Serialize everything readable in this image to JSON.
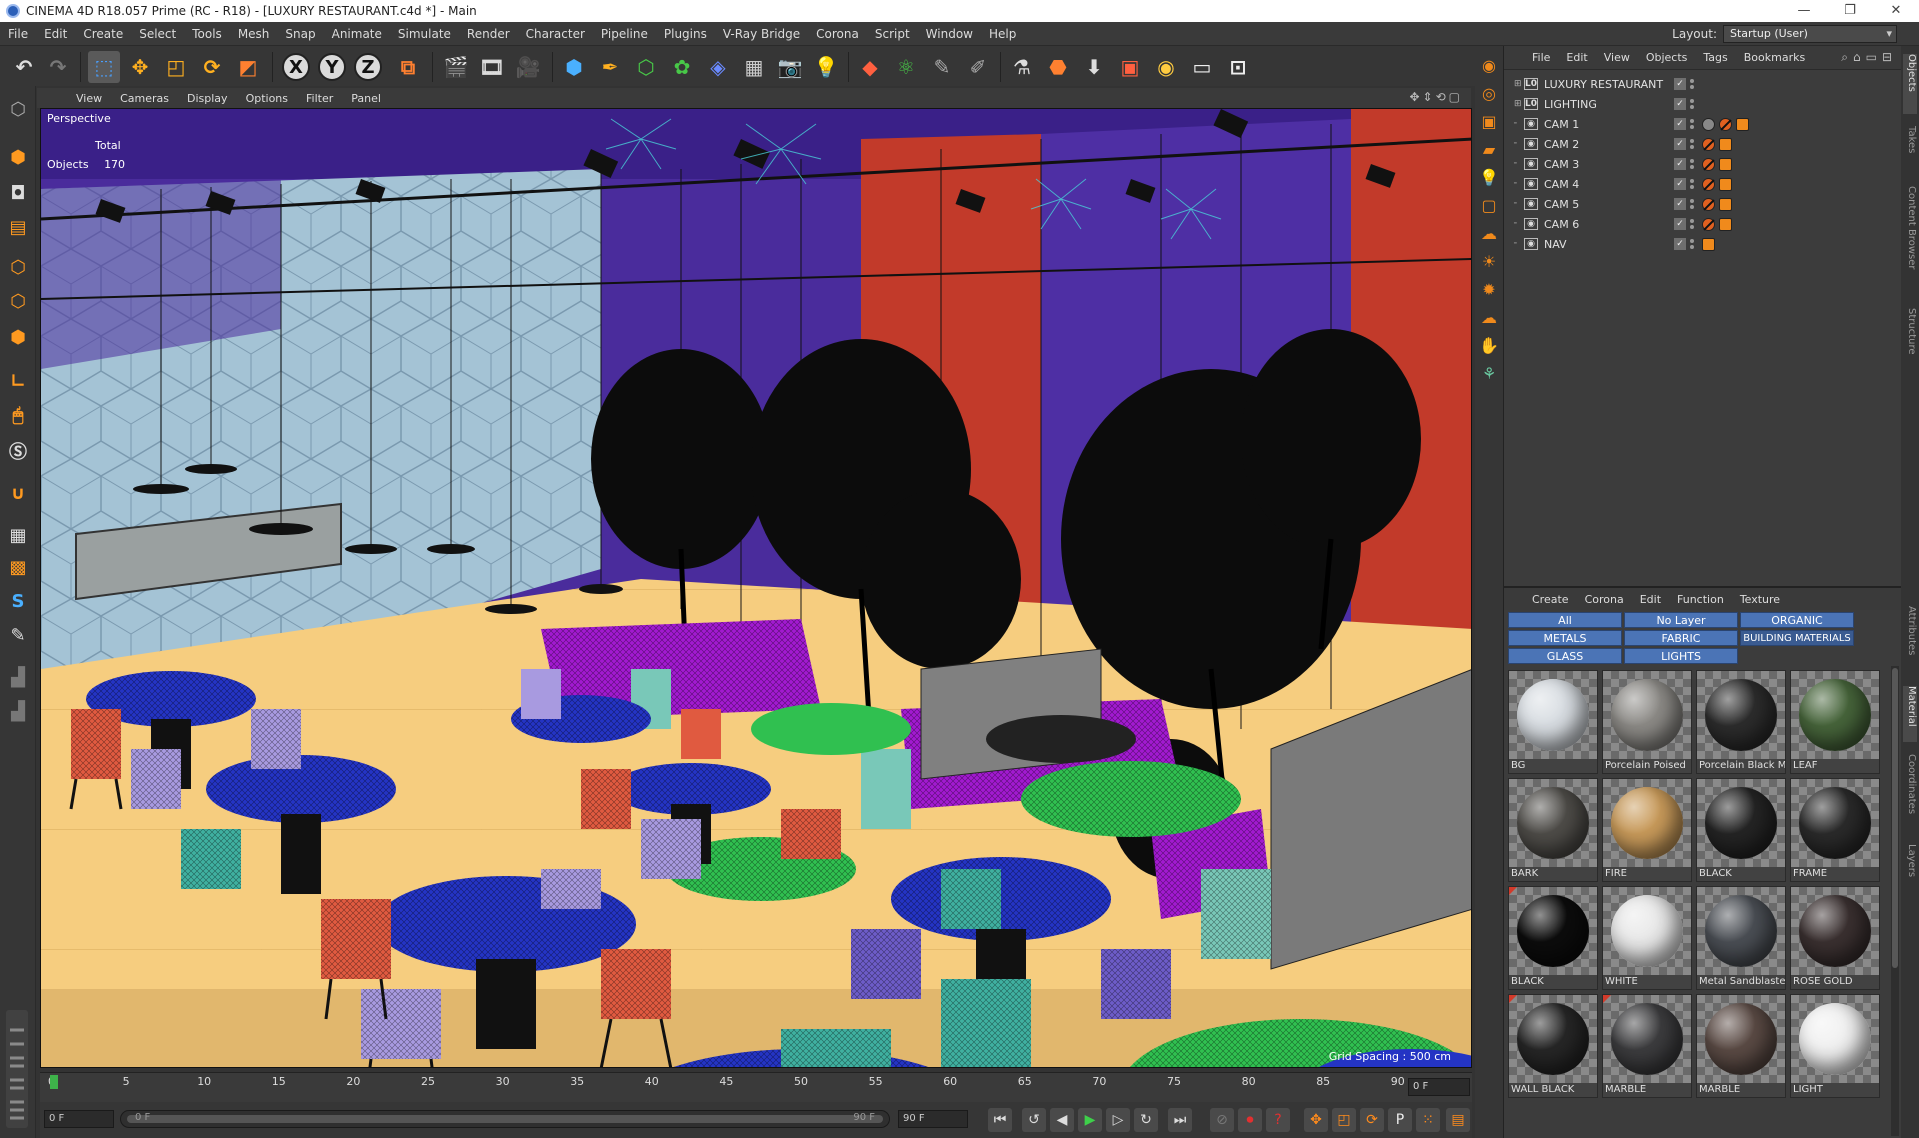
{
  "window": {
    "title": "CINEMA 4D R18.057 Prime (RC - R18) - [LUXURY RESTAURANT.c4d *] - Main",
    "controls": [
      "—",
      "❐",
      "✕"
    ]
  },
  "menu": {
    "items": [
      "File",
      "Edit",
      "Create",
      "Select",
      "Tools",
      "Mesh",
      "Snap",
      "Animate",
      "Simulate",
      "Render",
      "Character",
      "Pipeline",
      "Plugins",
      "V-Ray Bridge",
      "Corona",
      "Script",
      "Window",
      "Help"
    ],
    "layout_label": "Layout:",
    "layout_value": "Startup (User)"
  },
  "toolbar": {
    "axis_x": "X",
    "axis_y": "Y",
    "axis_z": "Z"
  },
  "viewport": {
    "menu": [
      "View",
      "Cameras",
      "Display",
      "Options",
      "Filter",
      "Panel"
    ],
    "label": "Perspective",
    "stats_total_label": "Total",
    "stats_objects_label": "Objects",
    "stats_objects_value": "170",
    "grid_spacing": "Grid Spacing : 500 cm"
  },
  "timeline": {
    "ticks": [
      "0",
      "5",
      "10",
      "15",
      "20",
      "25",
      "30",
      "35",
      "40",
      "45",
      "50",
      "55",
      "60",
      "65",
      "70",
      "75",
      "80",
      "85",
      "90"
    ],
    "current_frame": "0 F"
  },
  "transport": {
    "start_field": "0 F",
    "range_start": "0 F",
    "range_end": "90 F",
    "end_field": "90 F"
  },
  "object_manager": {
    "menu": [
      "File",
      "Edit",
      "View",
      "Objects",
      "Tags",
      "Bookmarks"
    ],
    "objects": [
      {
        "name": "LUXURY RESTAURANT",
        "type": "L0"
      },
      {
        "name": "LIGHTING",
        "type": "L0"
      },
      {
        "name": "CAM 1",
        "type": "cam"
      },
      {
        "name": "CAM 2",
        "type": "cam"
      },
      {
        "name": "CAM 3",
        "type": "cam"
      },
      {
        "name": "CAM 4",
        "type": "cam"
      },
      {
        "name": "CAM 5",
        "type": "cam"
      },
      {
        "name": "CAM 6",
        "type": "cam"
      },
      {
        "name": "NAV",
        "type": "cam"
      }
    ],
    "side_tabs": [
      "Objects",
      "Takes",
      "Content Browser",
      "Structure"
    ]
  },
  "material_manager": {
    "menu": [
      "Create",
      "Corona",
      "Edit",
      "Function",
      "Texture"
    ],
    "layers": [
      "All",
      "No Layer",
      "ORGANIC",
      "METALS",
      "FABRIC",
      "BUILDING MATERIALS",
      "GLASS",
      "LIGHTS"
    ],
    "materials": [
      {
        "name": "BG",
        "color": "#d8dde2"
      },
      {
        "name": "Porcelain Poised",
        "color": "#8c8a86"
      },
      {
        "name": "Porcelain Black M",
        "color": "#2c2c2c"
      },
      {
        "name": "LEAF",
        "color": "#46643a"
      },
      {
        "name": "BARK",
        "color": "#4e4c48"
      },
      {
        "name": "FIRE",
        "color": "#c89a5a"
      },
      {
        "name": "BLACK",
        "color": "#242424"
      },
      {
        "name": "FRAME",
        "color": "#2a2a2a"
      },
      {
        "name": "BLACK",
        "color": "#0c0c0c"
      },
      {
        "name": "WHITE",
        "color": "#e8e8e8"
      },
      {
        "name": "Metal Sandblaste",
        "color": "#4a4e54"
      },
      {
        "name": "ROSE GOLD",
        "color": "#3a3030"
      },
      {
        "name": "WALL BLACK",
        "color": "#262626"
      },
      {
        "name": "MARBLE",
        "color": "#3c3c3e"
      },
      {
        "name": "MARBLE",
        "color": "#5a4a44"
      },
      {
        "name": "LIGHT",
        "color": "#f0f0f0"
      }
    ],
    "side_tabs": [
      "Attributes",
      "Material",
      "Coordinates",
      "Layers"
    ]
  }
}
